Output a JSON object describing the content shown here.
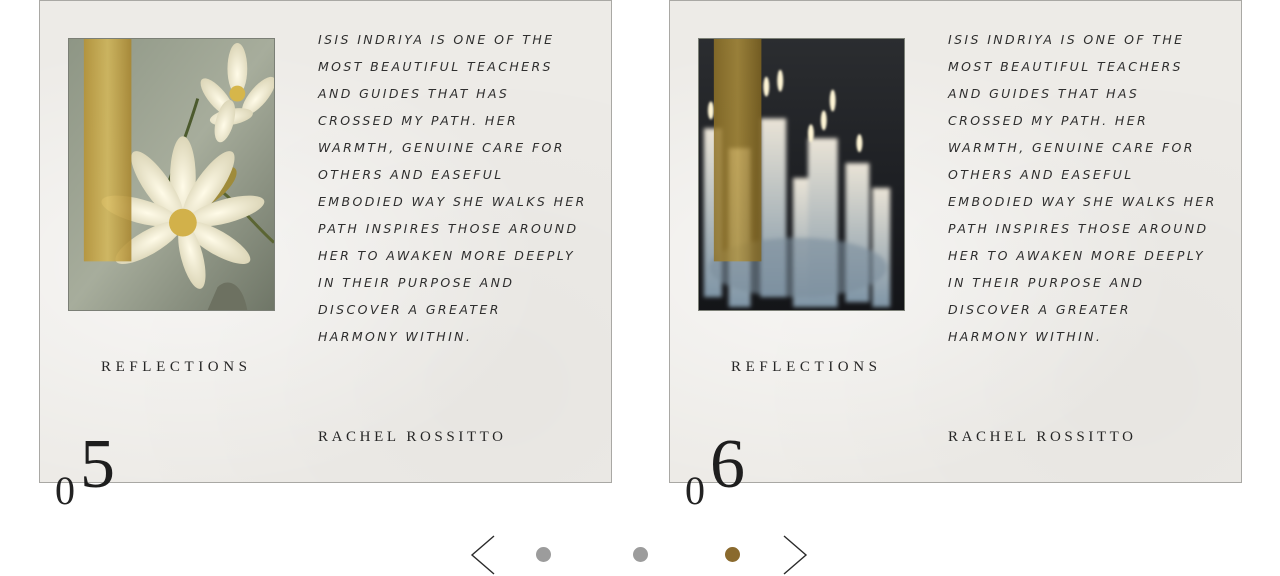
{
  "cards": [
    {
      "image": "white water lily flower with gold bar overlay",
      "quote": "ISIS INDRIYA IS ONE OF THE\nMOST BEAUTIFUL TEACHERS\nAND GUIDES THAT HAS\nCROSSED MY PATH. HER\nWARMTH, GENUINE CARE FOR\nOTHERS AND EASEFUL\nEMBODIED WAY SHE WALKS HER\nPATH INSPIRES THOSE AROUND\nHER TO AWAKEN MORE DEEPLY\nIN THEIR PURPOSE AND\nDISCOVER A GREATER\nHARMONY WITHIN.",
      "category": "REFLECTIONS",
      "author": "RACHEL ROSSITTO",
      "number_prefix": "0",
      "number": "5"
    },
    {
      "image": "blurred lit candles with gold bar overlay",
      "quote": "ISIS INDRIYA IS ONE OF THE\nMOST BEAUTIFUL TEACHERS\nAND GUIDES THAT HAS\nCROSSED MY PATH. HER\nWARMTH, GENUINE CARE FOR\nOTHERS AND EASEFUL\nEMBODIED WAY SHE WALKS HER\nPATH INSPIRES THOSE AROUND\nHER TO AWAKEN MORE DEEPLY\nIN THEIR PURPOSE AND\nDISCOVER A GREATER\nHARMONY WITHIN.",
      "category": "REFLECTIONS",
      "author": "RACHEL ROSSITTO",
      "number_prefix": "0",
      "number": "6"
    }
  ],
  "carousel": {
    "prev_icon": "chevron-left-icon",
    "next_icon": "chevron-right-icon",
    "dot_count": 3,
    "active_dot": 3
  },
  "colors": {
    "card_background": "#edebe7",
    "dot_inactive": "#9c9c9c",
    "dot_active": "#8a6a2e",
    "gold_bar": "#c9a63c"
  }
}
